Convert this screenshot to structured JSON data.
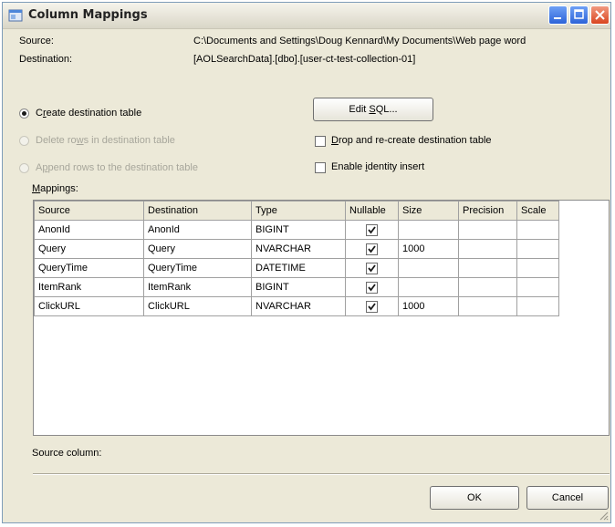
{
  "window": {
    "title": "Column Mappings"
  },
  "info": {
    "source_label": "Source:",
    "source_value": "C:\\Documents and Settings\\Doug Kennard\\My Documents\\Web page word",
    "destination_label": "Destination:",
    "destination_value": "[AOLSearchData].[dbo].[user-ct-test-collection-01]"
  },
  "options": {
    "create_prefix": "C",
    "create_accel": "r",
    "create_suffix": "eate destination table",
    "delete_prefix": "Delete ro",
    "delete_accel": "w",
    "delete_suffix": "s in destination table",
    "append_prefix": "A",
    "append_accel": "p",
    "append_suffix": "pend rows to the destination table",
    "selected": "create",
    "edit_sql_prefix": "Edit ",
    "edit_sql_accel": "S",
    "edit_sql_suffix": "QL...",
    "drop_accel": "D",
    "drop_suffix": "rop and re-create destination table",
    "identity_prefix": "Enable ",
    "identity_accel": "i",
    "identity_suffix": "dentity insert"
  },
  "mappings": {
    "label_accel": "M",
    "label_suffix": "appings:",
    "columns": [
      "Source",
      "Destination",
      "Type",
      "Nullable",
      "Size",
      "Precision",
      "Scale"
    ],
    "rows": [
      {
        "source": "AnonId",
        "destination": "AnonId",
        "type": "BIGINT",
        "nullable": true,
        "size": "",
        "precision": "",
        "scale": ""
      },
      {
        "source": "Query",
        "destination": "Query",
        "type": "NVARCHAR",
        "nullable": true,
        "size": "1000",
        "precision": "",
        "scale": ""
      },
      {
        "source": "QueryTime",
        "destination": "QueryTime",
        "type": "DATETIME",
        "nullable": true,
        "size": "",
        "precision": "",
        "scale": ""
      },
      {
        "source": "ItemRank",
        "destination": "ItemRank",
        "type": "BIGINT",
        "nullable": true,
        "size": "",
        "precision": "",
        "scale": ""
      },
      {
        "source": "ClickURL",
        "destination": "ClickURL",
        "type": "NVARCHAR",
        "nullable": true,
        "size": "1000",
        "precision": "",
        "scale": ""
      }
    ]
  },
  "footer": {
    "source_column_label": "Source column:",
    "ok_label": "OK",
    "cancel_label": "Cancel"
  },
  "colors": {
    "check": "#1a1a1a",
    "accent": "#2c63d8",
    "close": "#d9451f"
  }
}
